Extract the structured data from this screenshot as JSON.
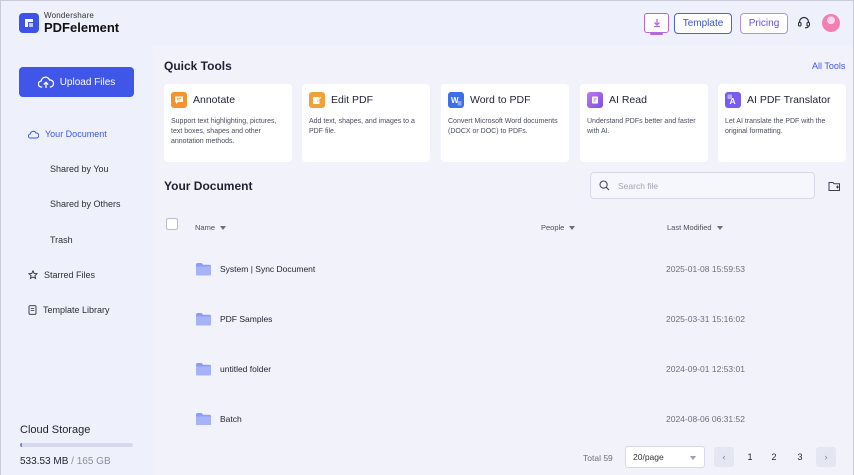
{
  "app": {
    "brand": "Wondershare",
    "product": "PDFelement"
  },
  "topbar": {
    "template_label": "Template",
    "pricing_label": "Pricing"
  },
  "sidebar": {
    "upload_label": "Upload Files",
    "items": [
      {
        "label": "Your Document",
        "icon": "cloud-icon",
        "active": true
      },
      {
        "label": "Shared by You"
      },
      {
        "label": "Shared by Others"
      },
      {
        "label": "Trash"
      },
      {
        "label": "Starred Files",
        "icon": "star-icon"
      },
      {
        "label": "Template Library",
        "icon": "document-icon"
      }
    ],
    "storage": {
      "label": "Cloud Storage",
      "used": "533.53 MB",
      "separator": " / ",
      "total": "165 GB",
      "fraction": 0.0032
    }
  },
  "quick_tools": {
    "title": "Quick Tools",
    "all_tools_label": "All Tools",
    "tools": [
      {
        "name": "Annotate",
        "desc": "Support text highlighting, pictures, text boxes, shapes and other annotation methods.",
        "icon": "annotate-icon",
        "color": "#f5922e"
      },
      {
        "name": "Edit PDF",
        "desc": "Add text, shapes, and images to a PDF file.",
        "icon": "edit-pdf-icon",
        "color": "#f0a23a"
      },
      {
        "name": "Word to PDF",
        "desc": "Convert Microsoft Word documents (DOCX or DOC) to PDFs.",
        "icon": "word-icon",
        "color": "#3f6fe8"
      },
      {
        "name": "AI Read",
        "desc": "Understand PDFs better and faster with AI.",
        "icon": "ai-read-icon",
        "color": "#8a55e6"
      },
      {
        "name": "AI PDF Translator",
        "desc": "Let AI translate the PDF with the original formatting.",
        "icon": "translate-icon",
        "color": "#7a5cf0"
      }
    ]
  },
  "documents": {
    "title": "Your Document",
    "search_placeholder": "Search file",
    "columns": {
      "name": "Name",
      "people": "People",
      "modified": "Last Modified"
    },
    "rows": [
      {
        "name": "System | Sync Document",
        "modified": "2025-01-08 15:59:53"
      },
      {
        "name": "PDF Samples",
        "modified": "2025-03-31 15:16:02"
      },
      {
        "name": "untitled folder",
        "modified": "2024-09-01 12:53:01"
      },
      {
        "name": "Batch",
        "modified": "2024-08-06 06:31:52"
      }
    ]
  },
  "pagination": {
    "total": "Total 59",
    "per_page": "20/page",
    "pages": [
      "1",
      "2",
      "3"
    ],
    "prev": "‹",
    "next": "›"
  },
  "colors": {
    "accent": "#3f56e8",
    "folder": "#8e9cf3"
  }
}
